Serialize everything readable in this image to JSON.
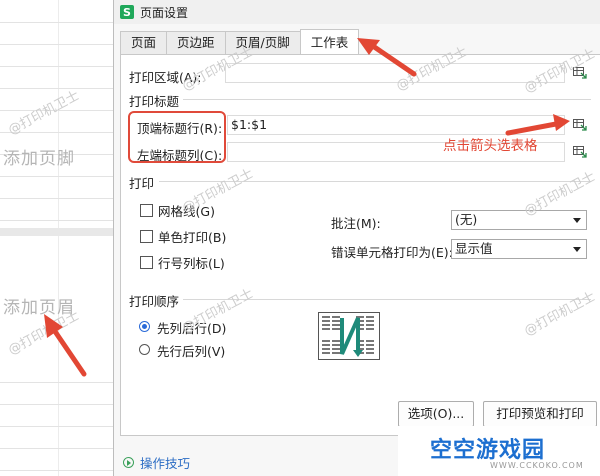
{
  "window": {
    "app_icon": "S",
    "title": "页面设置"
  },
  "tabs": [
    {
      "label": "页面",
      "active": false
    },
    {
      "label": "页边距",
      "active": false
    },
    {
      "label": "页眉/页脚",
      "active": false
    },
    {
      "label": "工作表",
      "active": true
    }
  ],
  "print_area": {
    "label": "打印区域(A):",
    "value": ""
  },
  "print_titles": {
    "section": "打印标题",
    "top_rows_label": "顶端标题行(R):",
    "top_rows_value": "$1:$1",
    "left_cols_label": "左端标题列(C):",
    "left_cols_value": ""
  },
  "print": {
    "section": "打印",
    "gridlines": {
      "label": "网格线(G)",
      "checked": false
    },
    "black_white": {
      "label": "单色打印(B)",
      "checked": false
    },
    "row_col_headings": {
      "label": "行号列标(L)",
      "checked": false
    },
    "comments_label": "批注(M):",
    "comments_value": "(无)",
    "errors_label": "错误单元格打印为(E):",
    "errors_value": "显示值"
  },
  "page_order": {
    "section": "打印顺序",
    "down_then_over": {
      "label": "先列后行(D)",
      "selected": true
    },
    "over_then_down": {
      "label": "先行后列(V)",
      "selected": false
    }
  },
  "buttons": {
    "options": "选项(O)...",
    "print_preview": "打印预览和打印(P)..."
  },
  "tips_link": "操作技巧",
  "annotation": "点击箭头选表格",
  "sheet_placeholders": {
    "footer": "添加页脚",
    "header": "添加页眉"
  },
  "watermark": "@打印机卫士",
  "logo": {
    "text": "空空游戏园",
    "sub": "WWW.CCKOKO.COM"
  },
  "colors": {
    "accent": "#2a6ad8",
    "annotation": "#e24734",
    "link": "#2b6cc4"
  }
}
